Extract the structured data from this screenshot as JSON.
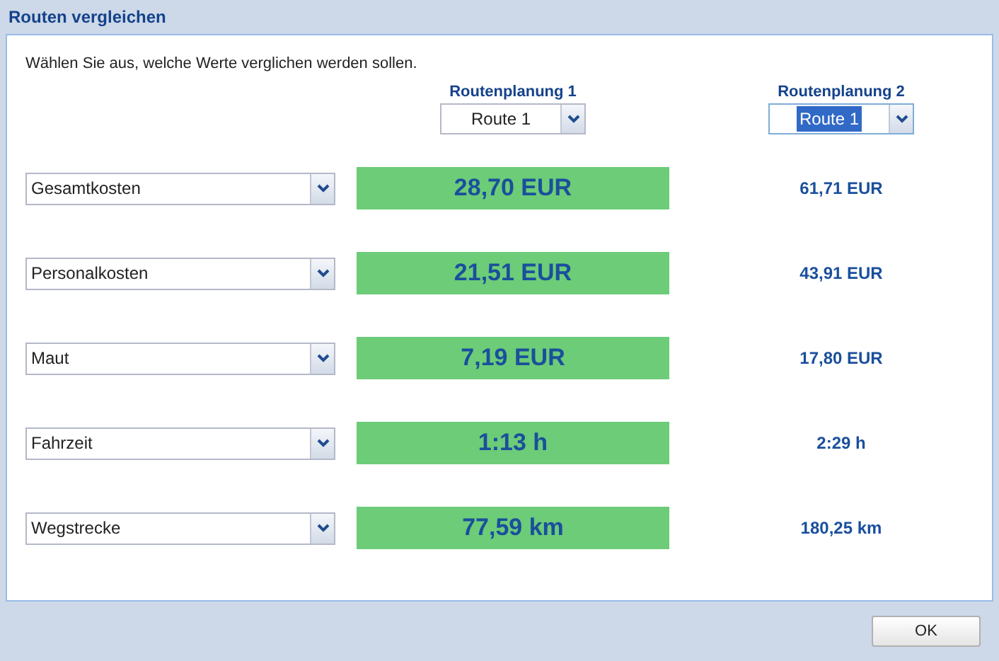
{
  "window": {
    "title": "Routen vergleichen"
  },
  "instruction": "Wählen Sie aus, welche Werte verglichen werden sollen.",
  "plans": [
    {
      "heading": "Routenplanung 1",
      "route": "Route 1",
      "focused": false
    },
    {
      "heading": "Routenplanung 2",
      "route": "Route 1",
      "focused": true
    }
  ],
  "rows": [
    {
      "metric": "Gesamtkosten",
      "values": [
        {
          "text": "28,70 EUR",
          "highlighted": true
        },
        {
          "text": "61,71 EUR",
          "highlighted": false
        }
      ]
    },
    {
      "metric": "Personalkosten",
      "values": [
        {
          "text": "21,51 EUR",
          "highlighted": true
        },
        {
          "text": "43,91 EUR",
          "highlighted": false
        }
      ]
    },
    {
      "metric": "Maut",
      "values": [
        {
          "text": "7,19 EUR",
          "highlighted": true
        },
        {
          "text": "17,80 EUR",
          "highlighted": false
        }
      ]
    },
    {
      "metric": "Fahrzeit",
      "values": [
        {
          "text": "1:13 h",
          "highlighted": true
        },
        {
          "text": "2:29 h",
          "highlighted": false
        }
      ]
    },
    {
      "metric": "Wegstrecke",
      "values": [
        {
          "text": "77,59 km",
          "highlighted": true
        },
        {
          "text": "180,25 km",
          "highlighted": false
        }
      ]
    }
  ],
  "buttons": [
    "OK"
  ]
}
